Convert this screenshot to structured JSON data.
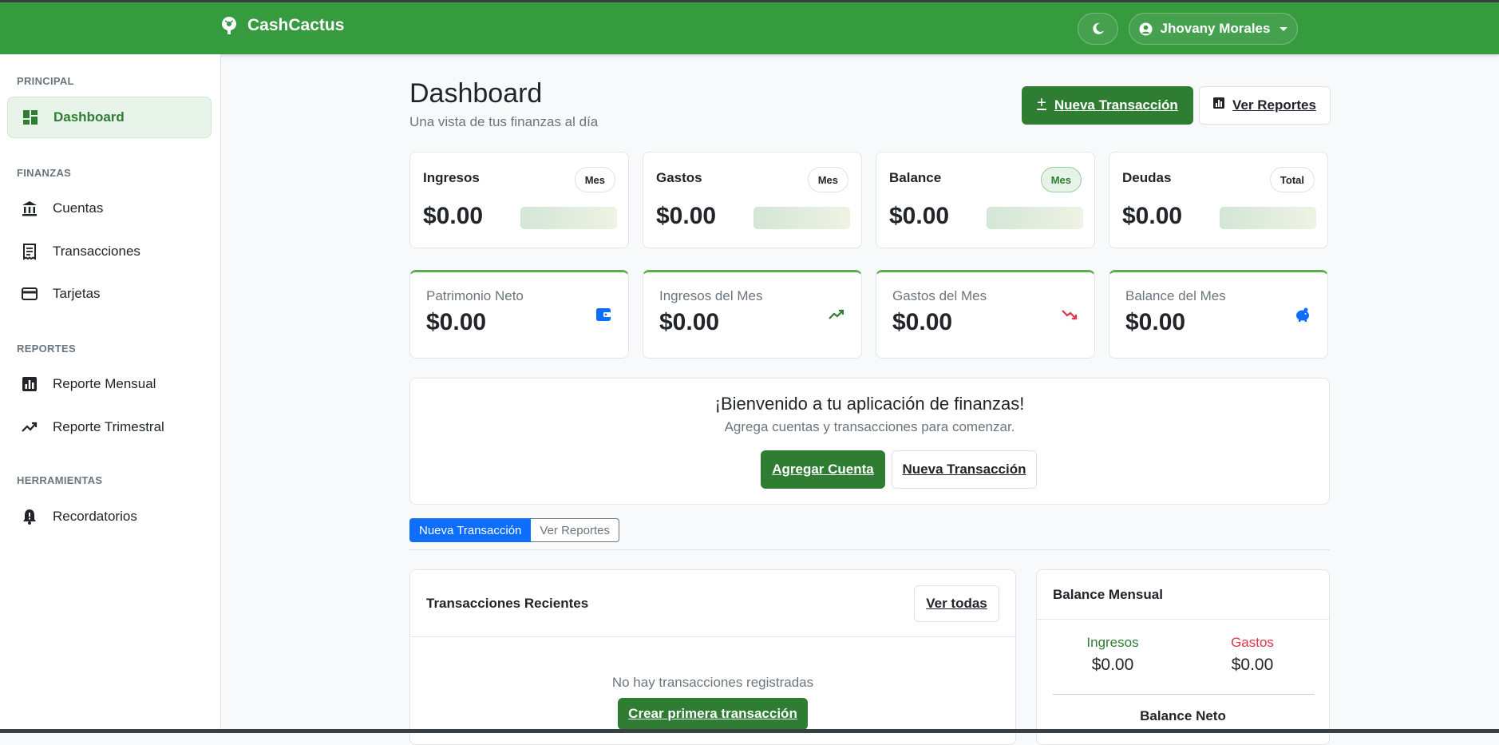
{
  "header": {
    "brand": "CashCactus",
    "user_name": "Jhovany Morales"
  },
  "sidebar": {
    "sections": [
      {
        "title": "PRINCIPAL"
      },
      {
        "title": "FINANZAS"
      },
      {
        "title": "REPORTES"
      },
      {
        "title": "HERRAMIENTAS"
      }
    ],
    "items": [
      {
        "label": "Dashboard",
        "icon": "dashboard-icon"
      },
      {
        "label": "Cuentas",
        "icon": "bank-icon"
      },
      {
        "label": "Transacciones",
        "icon": "receipt-icon"
      },
      {
        "label": "Tarjetas",
        "icon": "credit-card-icon"
      },
      {
        "label": "Reporte Mensual",
        "icon": "bar-chart-icon"
      },
      {
        "label": "Reporte Trimestral",
        "icon": "trending-up-icon"
      },
      {
        "label": "Recordatorios",
        "icon": "bell-icon"
      }
    ]
  },
  "main": {
    "title": "Dashboard",
    "subtitle": "Una vista de tus finanzas al día",
    "new_transaction_label": "Nueva Transacción",
    "reports_label": "Ver Reportes",
    "stats": [
      {
        "label": "Ingresos",
        "badge": "Mes",
        "value": "$0.00"
      },
      {
        "label": "Gastos",
        "badge": "Mes",
        "value": "$0.00"
      },
      {
        "label": "Balance",
        "badge": "Mes",
        "value": "$0.00"
      },
      {
        "label": "Deudas",
        "badge": "Total",
        "value": "$0.00"
      }
    ],
    "summaries": [
      {
        "label": "Patrimonio Neto",
        "value": "$0.00",
        "icon": "wallet-icon"
      },
      {
        "label": "Ingresos del Mes",
        "value": "$0.00",
        "icon": "trending-up-icon"
      },
      {
        "label": "Gastos del Mes",
        "value": "$0.00",
        "icon": "trending-down-icon"
      },
      {
        "label": "Balance del Mes",
        "value": "$0.00",
        "icon": "piggy-bank-icon"
      }
    ],
    "welcome": {
      "title": "¡Bienvenido a tu aplicación de finanzas!",
      "subtitle": "Agrega cuentas y transacciones para comenzar.",
      "add_account": "Agregar Cuenta",
      "new_transaction": "Nueva Transacción"
    },
    "pills": {
      "active": "Nueva Transacción",
      "inactive": "Ver Reportes"
    },
    "recent": {
      "title": "Transacciones Recientes",
      "view_all": "Ver todas",
      "empty": "No hay transacciones registradas",
      "create_first": "Crear primera transacción"
    },
    "monthly_balance": {
      "title": "Balance Mensual",
      "income_label": "Ingresos",
      "income_value": "$0.00",
      "expense_label": "Gastos",
      "expense_value": "$0.00",
      "net_label": "Balance Neto"
    }
  },
  "colors": {
    "brand_green": "#369a3f",
    "button_green": "#2e7d32",
    "income_green": "#2e7d32",
    "expense_red": "#dc3545",
    "primary_blue": "#0d6efd"
  }
}
